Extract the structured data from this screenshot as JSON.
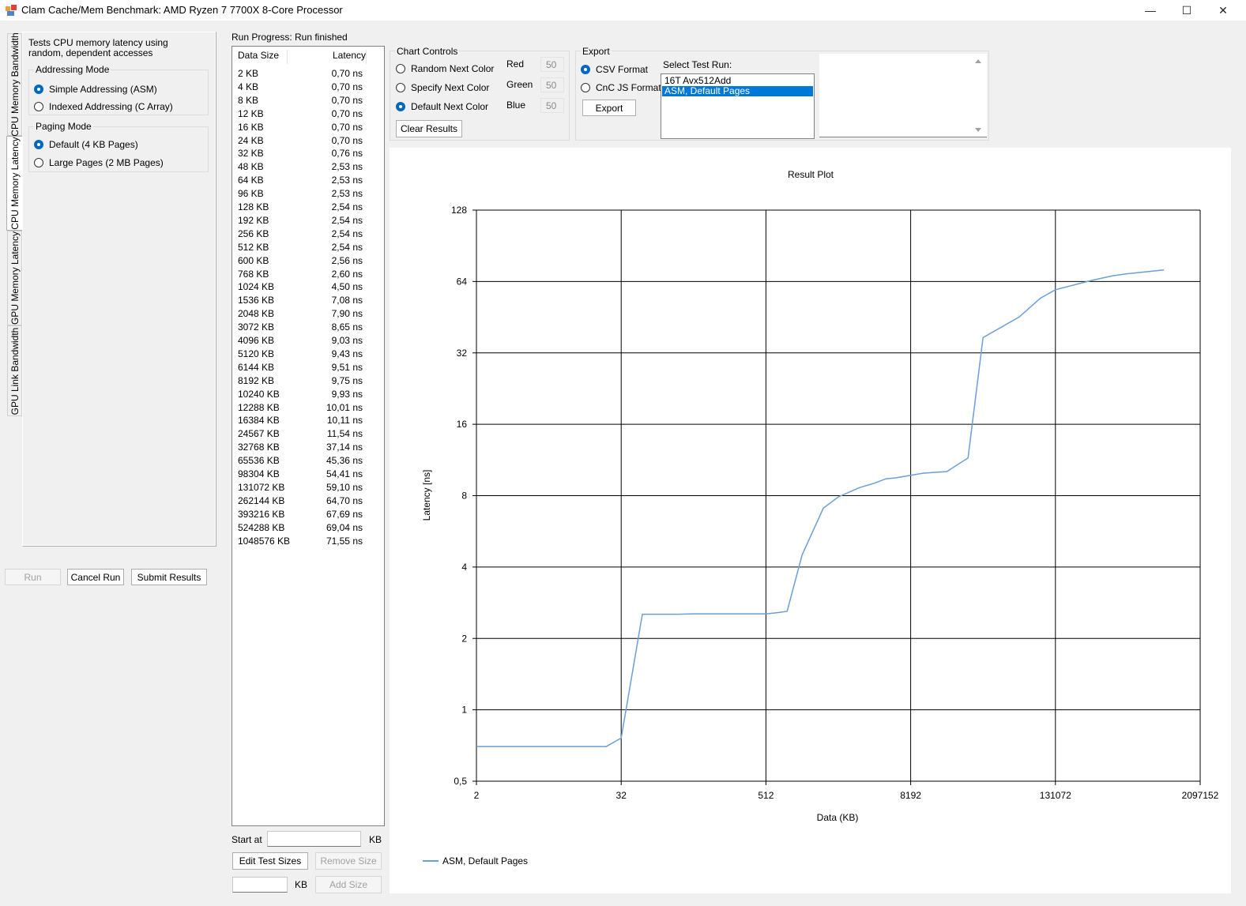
{
  "window": {
    "title": "Clam Cache/Mem Benchmark: AMD Ryzen 7 7700X 8-Core Processor",
    "minimize": "—",
    "maximize": "☐",
    "close": "✕"
  },
  "tabs": [
    {
      "label": "CPU Memory Bandwidth",
      "active": false
    },
    {
      "label": "CPU Memory Latency",
      "active": true
    },
    {
      "label": "GPU Memory Latency",
      "active": false
    },
    {
      "label": "GPU Link Bandwidth",
      "active": false
    }
  ],
  "latency_page": {
    "description": "Tests CPU memory latency using random, dependent accesses",
    "addressing_mode": {
      "title": "Addressing Mode",
      "options": [
        {
          "label": "Simple Addressing (ASM)",
          "checked": true
        },
        {
          "label": "Indexed Addressing (C Array)",
          "checked": false
        }
      ]
    },
    "paging_mode": {
      "title": "Paging Mode",
      "options": [
        {
          "label": "Default (4 KB Pages)",
          "checked": true
        },
        {
          "label": "Large Pages (2 MB Pages)",
          "checked": false
        }
      ]
    }
  },
  "actions": {
    "run": "Run",
    "cancel_run": "Cancel Run",
    "submit_results": "Submit Results"
  },
  "progress": {
    "label": "Run Progress:",
    "status": "Run finished"
  },
  "results_list": {
    "headers": [
      "Data Size",
      "Latency"
    ],
    "rows": [
      [
        "2 KB",
        "0,70 ns"
      ],
      [
        "4 KB",
        "0,70 ns"
      ],
      [
        "8 KB",
        "0,70 ns"
      ],
      [
        "12 KB",
        "0,70 ns"
      ],
      [
        "16 KB",
        "0,70 ns"
      ],
      [
        "24 KB",
        "0,70 ns"
      ],
      [
        "32 KB",
        "0,76 ns"
      ],
      [
        "48 KB",
        "2,53 ns"
      ],
      [
        "64 KB",
        "2,53 ns"
      ],
      [
        "96 KB",
        "2,53 ns"
      ],
      [
        "128 KB",
        "2,54 ns"
      ],
      [
        "192 KB",
        "2,54 ns"
      ],
      [
        "256 KB",
        "2,54 ns"
      ],
      [
        "512 KB",
        "2,54 ns"
      ],
      [
        "600 KB",
        "2,56 ns"
      ],
      [
        "768 KB",
        "2,60 ns"
      ],
      [
        "1024 KB",
        "4,50 ns"
      ],
      [
        "1536 KB",
        "7,08 ns"
      ],
      [
        "2048 KB",
        "7,90 ns"
      ],
      [
        "3072 KB",
        "8,65 ns"
      ],
      [
        "4096 KB",
        "9,03 ns"
      ],
      [
        "5120 KB",
        "9,43 ns"
      ],
      [
        "6144 KB",
        "9,51 ns"
      ],
      [
        "8192 KB",
        "9,75 ns"
      ],
      [
        "10240 KB",
        "9,93 ns"
      ],
      [
        "12288 KB",
        "10,01 ns"
      ],
      [
        "16384 KB",
        "10,11 ns"
      ],
      [
        "24567 KB",
        "11,54 ns"
      ],
      [
        "32768 KB",
        "37,14 ns"
      ],
      [
        "65536 KB",
        "45,36 ns"
      ],
      [
        "98304 KB",
        "54,41 ns"
      ],
      [
        "131072 KB",
        "59,10 ns"
      ],
      [
        "262144 KB",
        "64,70 ns"
      ],
      [
        "393216 KB",
        "67,69 ns"
      ],
      [
        "524288 KB",
        "69,04 ns"
      ],
      [
        "1048576 KB",
        "71,55 ns"
      ]
    ]
  },
  "test_sizes": {
    "start_at_label": "Start at",
    "start_at_value": "",
    "kb_label": "KB",
    "edit_test_sizes": "Edit Test Sizes",
    "remove_size": "Remove Size",
    "add_size_value": "",
    "add_size_kb_label": "KB",
    "add_size": "Add Size"
  },
  "chart_controls": {
    "title": "Chart Controls",
    "options": [
      {
        "label": "Random Next Color",
        "checked": false
      },
      {
        "label": "Specify Next Color",
        "checked": false
      },
      {
        "label": "Default Next Color",
        "checked": true
      }
    ],
    "red_label": "Red",
    "red_value": "50",
    "green_label": "Green",
    "green_value": "50",
    "blue_label": "Blue",
    "blue_value": "50",
    "clear_results": "Clear Results"
  },
  "export": {
    "title": "Export",
    "csv_format": "CSV Format",
    "csv_checked": true,
    "cnc_js_format": "CnC JS Format",
    "cnc_checked": false,
    "export_button": "Export",
    "select_test_run_label": "Select Test Run:",
    "test_runs": [
      {
        "label": "16T Avx512Add",
        "selected": false
      },
      {
        "label": "ASM, Default Pages",
        "selected": true
      }
    ],
    "output_text": ""
  },
  "colors": {
    "accent": "#0067c0",
    "series": "#6a9fd8",
    "selection": "#0078d7"
  },
  "chart_data": {
    "type": "line",
    "title": "Result Plot",
    "xlabel": "Data (KB)",
    "ylabel": "Latency [ns]",
    "x_scale": "log2",
    "y_scale": "log2",
    "xlim": [
      2,
      2097152
    ],
    "ylim": [
      0.5,
      128
    ],
    "x_ticks": [
      2,
      32,
      512,
      8192,
      131072,
      2097152
    ],
    "x_tick_labels": [
      "2",
      "32",
      "512",
      "8192",
      "131072",
      "2097152"
    ],
    "y_ticks": [
      0.5,
      1,
      2,
      4,
      8,
      16,
      32,
      64,
      128
    ],
    "y_tick_labels": [
      "0,5",
      "1",
      "2",
      "4",
      "8",
      "16",
      "32",
      "64",
      "128"
    ],
    "grid": true,
    "legend_position": "bottom-left",
    "series": [
      {
        "name": "ASM, Default Pages",
        "x": [
          2,
          4,
          8,
          12,
          16,
          24,
          32,
          48,
          64,
          96,
          128,
          192,
          256,
          512,
          600,
          768,
          1024,
          1536,
          2048,
          3072,
          4096,
          5120,
          6144,
          8192,
          10240,
          12288,
          16384,
          24567,
          32768,
          65536,
          98304,
          131072,
          262144,
          393216,
          524288,
          1048576
        ],
        "y": [
          0.7,
          0.7,
          0.7,
          0.7,
          0.7,
          0.7,
          0.76,
          2.53,
          2.53,
          2.53,
          2.54,
          2.54,
          2.54,
          2.54,
          2.56,
          2.6,
          4.5,
          7.08,
          7.9,
          8.65,
          9.03,
          9.43,
          9.51,
          9.75,
          9.93,
          10.01,
          10.11,
          11.54,
          37.14,
          45.36,
          54.41,
          59.1,
          64.7,
          67.69,
          69.04,
          71.55
        ]
      }
    ]
  }
}
